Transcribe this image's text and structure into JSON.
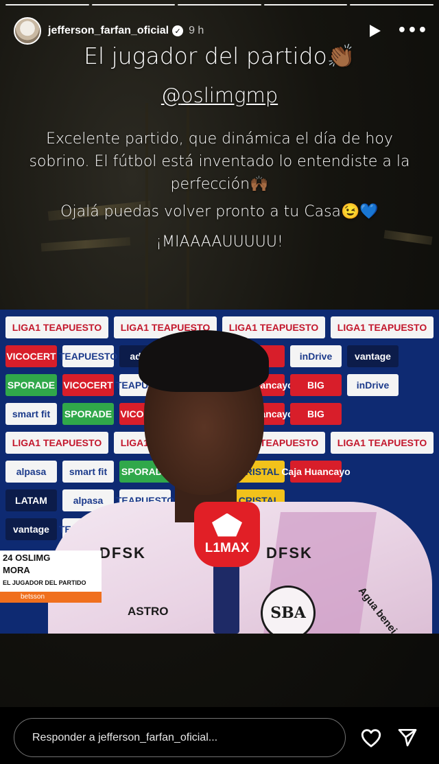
{
  "header": {
    "username": "jefferson_farfan_oficial",
    "verified_glyph": "✓",
    "time": "9 h",
    "icons": [
      "play-icon",
      "more-icon"
    ],
    "more_glyph": "•••"
  },
  "story": {
    "title": "El jugador del partido👏🏾",
    "mention_at": "@",
    "mention_handle": "oslimgmp",
    "message": "Excelente partido, que dinámica el día de hoy sobrino. El fútbol está inventado lo entendiste a la perfección🙌🏾",
    "message2": "Ojalá puedas volver pronto a tu Casa😉💙",
    "message3": "¡MIAAAAUUUUU!"
  },
  "tv": {
    "sponsors": {
      "liga": "LIGA1 TEAPUESTO",
      "vicocert": "VICOCERT",
      "teapuesto": "TEAPUESTO",
      "big": "BIG",
      "indrive": "inDrive",
      "vantage": "vantage",
      "sporade": "SPORADE",
      "smartfit": "smart fit",
      "caja": "Caja Huancayo",
      "cristal": "CRISTAL",
      "alpasa": "alpasa",
      "latam": "LATAM",
      "adidas": "adidas"
    },
    "shirt": {
      "brand_left": "DFSK",
      "brand_right": "DFSK",
      "astro": "ASTRO",
      "seal": "SBA",
      "agua": "Agua benei"
    },
    "microphone": {
      "label": "L1MAX"
    },
    "lower_third": {
      "name_line1": "24 OSLIMG",
      "name_line2": "MORA",
      "role": "EL JUGADOR DEL PARTIDO",
      "sponsor": "betsson"
    }
  },
  "reply": {
    "placeholder": "Responder a jefferson_farfan_oficial..."
  },
  "colors": {
    "accent_red": "#e11f26",
    "tv_background": "#0e2a72",
    "lower_third_bar": "#f06f1d"
  }
}
